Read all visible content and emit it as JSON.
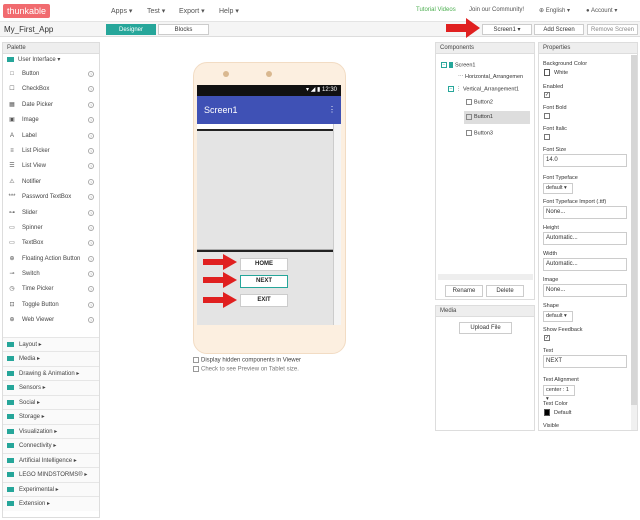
{
  "nav": {
    "logo": "thunkable",
    "menus": [
      "Apps",
      "Test",
      "Export",
      "Help"
    ],
    "tutorial": "Tutorial Videos",
    "community": "Join our Community!",
    "language": "English",
    "account": "Account"
  },
  "toolbar": {
    "project": "My_First_App",
    "designer": "Designer",
    "blocks": "Blocks",
    "screen_select": "Screen1",
    "add_screen": "Add Screen",
    "remove_screen": "Remove Screen"
  },
  "palette": {
    "title": "Palette",
    "open_category": "User Interface",
    "items": [
      "Button",
      "CheckBox",
      "Date Picker",
      "Image",
      "Label",
      "List Picker",
      "List View",
      "Notifier",
      "Password TextBox",
      "Slider",
      "Spinner",
      "TextBox",
      "Floating Action Button",
      "Switch",
      "Time Picker",
      "Toggle Button",
      "Web Viewer"
    ],
    "icons": [
      "□",
      "☐",
      "▦",
      "▣",
      "A",
      "≡",
      "☰",
      "⚠",
      "***",
      "⊶",
      "▭",
      "▭",
      "⊕",
      "⊸",
      "◷",
      "⊡",
      "⊕"
    ],
    "categories": [
      "Layout",
      "Media",
      "Drawing & Animation",
      "Sensors",
      "Social",
      "Storage",
      "Visualization",
      "Connectivity",
      "Artificial Intelligence",
      "LEGO MINDSTORMS®",
      "Experimental",
      "Extension"
    ]
  },
  "viewer": {
    "status_time": "12:30",
    "screen_title": "Screen1",
    "buttons": [
      "HOME",
      "NEXT",
      "EXIT"
    ],
    "check_hidden": "Display hidden components in Viewer",
    "check_tablet": "Check to see Preview on Tablet size."
  },
  "components": {
    "title": "Components",
    "tree": [
      "Screen1",
      "Horizontal_Arrangemen",
      "Vertical_Arrangement1",
      "Button2",
      "Button1",
      "Button3"
    ],
    "rename": "Rename",
    "delete": "Delete"
  },
  "media": {
    "title": "Media",
    "upload": "Upload File"
  },
  "properties": {
    "title": "Properties",
    "bg_color_label": "Background Color",
    "bg_color": "White",
    "enabled_label": "Enabled",
    "font_bold_label": "Font Bold",
    "font_italic_label": "Font Italic",
    "font_size_label": "Font Size",
    "font_size": "14.0",
    "font_typeface_label": "Font Typeface",
    "font_typeface": "default",
    "font_import_label": "Font Typeface Import (.ttf)",
    "font_import": "None...",
    "height_label": "Height",
    "height": "Automatic...",
    "width_label": "Width",
    "width": "Automatic...",
    "image_label": "Image",
    "image": "None...",
    "shape_label": "Shape",
    "shape": "default",
    "feedback_label": "Show Feedback",
    "text_label": "Text",
    "text": "NEXT",
    "align_label": "Text Alignment",
    "align": "center : 1",
    "text_color_label": "Text Color",
    "text_color": "Default",
    "visible_label": "Visible"
  },
  "colors": {
    "brand": "#f16b6f",
    "accent": "#26a69a",
    "appbar": "#3f51b5",
    "arrow": "#e02020"
  }
}
